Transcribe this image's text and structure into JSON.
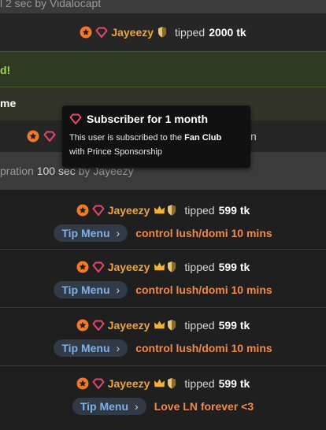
{
  "top_notice": {
    "text": "l 2 sec by Vidalocapt"
  },
  "tip_row_1": {
    "username": "Jayeezy",
    "verb": "tipped",
    "amount": "2000 tk"
  },
  "green_notice": {
    "text": "d!"
  },
  "olive_notice": {
    "text": "me"
  },
  "hidden_row": {
    "trailing": "n"
  },
  "duration_notice": {
    "prefix": "pration",
    "value": "100 sec",
    "suffix": "by Jayeezy"
  },
  "tooltip": {
    "title": "Subscriber for 1 month",
    "body_1": "This user is subscribed to the",
    "body_bold": "Fan Club",
    "body_2": "with Prince Sponsorship"
  },
  "tips": [
    {
      "username": "Jayeezy",
      "verb": "tipped",
      "amount": "599 tk",
      "menu_label": "Tip Menu",
      "message": "control lush/domi 10 mins"
    },
    {
      "username": "Jayeezy",
      "verb": "tipped",
      "amount": "599 tk",
      "menu_label": "Tip Menu",
      "message": "control lush/domi 10 mins"
    },
    {
      "username": "Jayeezy",
      "verb": "tipped",
      "amount": "599 tk",
      "menu_label": "Tip Menu",
      "message": "control lush/domi 10 mins"
    },
    {
      "username": "Jayeezy",
      "verb": "tipped",
      "amount": "599 tk",
      "menu_label": "Tip Menu",
      "message": "Love LN forever <3"
    }
  ],
  "icons": {
    "star_badge": "star-badge-icon",
    "gem": "diamond-icon",
    "crown": "crown-icon",
    "shield": "shield-icon",
    "chevron": "chevron-right-icon"
  },
  "colors": {
    "username": "#f0a33a",
    "tip_message": "#f08a4b",
    "tip_menu_text": "#7fb0e6",
    "gem": "#e8456b",
    "green_notice": "#a3d94d"
  }
}
